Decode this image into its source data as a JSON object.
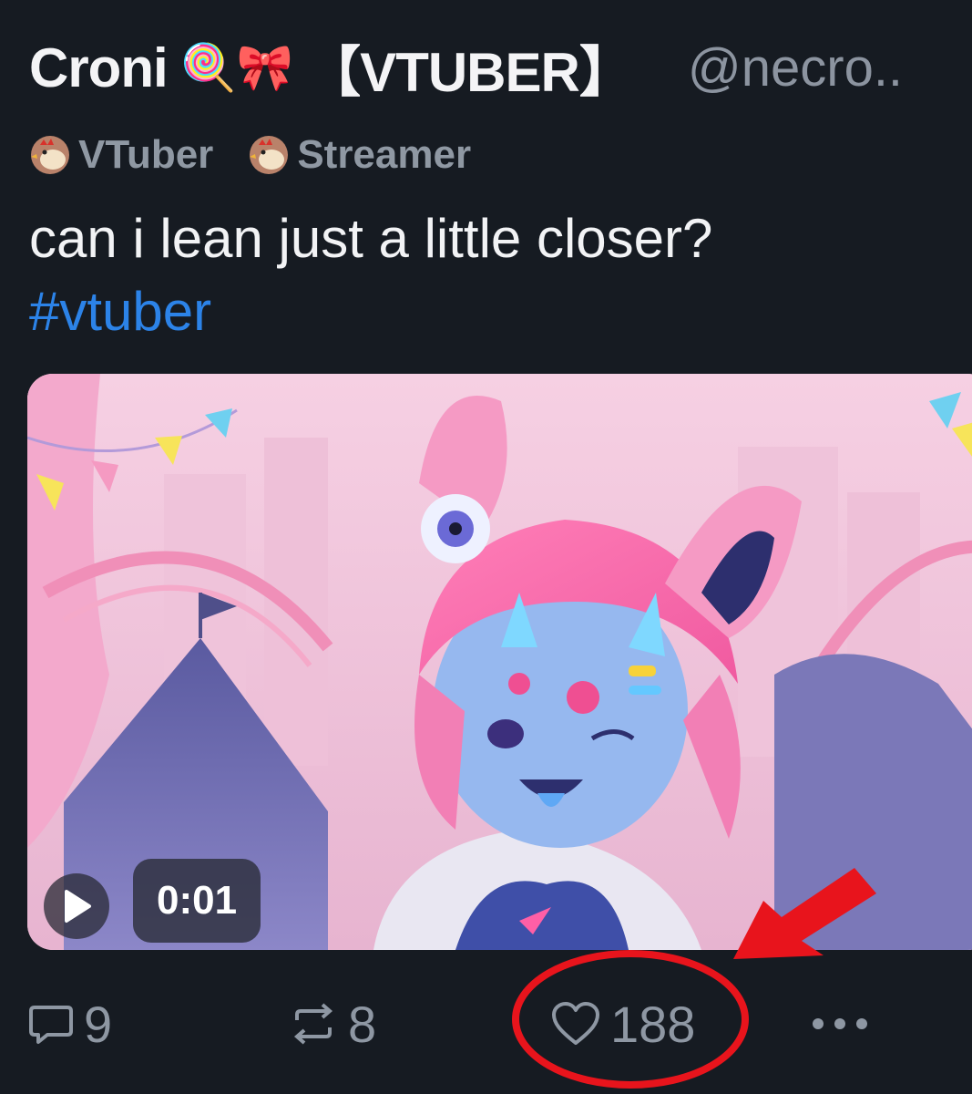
{
  "post": {
    "author_name": "Croni",
    "author_emoji": "🍭🎀",
    "author_tag": "【VTUBER】",
    "handle": "@necro..",
    "badges": [
      {
        "label": "VTuber",
        "icon": "chicken-icon"
      },
      {
        "label": "Streamer",
        "icon": "chicken-icon"
      }
    ],
    "text": "can i lean just a little closer?",
    "hashtag": "#vtuber"
  },
  "media": {
    "type": "video",
    "duration": "0:01",
    "play_icon": "play-icon"
  },
  "actions": {
    "replies": "9",
    "reposts": "8",
    "likes": "188",
    "reply_icon": "comment-icon",
    "repost_icon": "repost-icon",
    "like_icon": "heart-icon",
    "more_icon": "more-icon"
  },
  "annotation": {
    "color": "#e8141c",
    "target": "likes"
  }
}
